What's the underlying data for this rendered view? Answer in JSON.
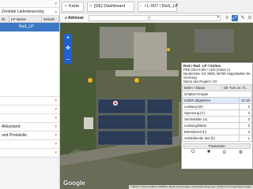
{
  "sidebar": {
    "top_group_label": "Zentrale Ladesteuerung",
    "table_headers": [
      "ID",
      "LP-Name",
      "Details"
    ],
    "selected_row_label": "RaS_LP",
    "bottom_groups": [
      "",
      "",
      "",
      "Akkustand",
      "und Protokolle",
      "",
      ""
    ]
  },
  "tabs": [
    {
      "label": "Karte",
      "type": "close"
    },
    {
      "label": "[DE] Dashboard",
      "type": "close"
    },
    {
      "label": "/ L-007 / RaS_LP",
      "type": "arrow"
    }
  ],
  "toolbar": {
    "address_label": "Adresse",
    "address_value": "",
    "select_value": ""
  },
  "map": {
    "attribution": "©Bilder © 2023 GeoBasis-DE/BKG, Maxar Technologies | Nutzungsbedingungen | Fehler bei Google Maps melden",
    "google_logo": "Google"
  },
  "panel": {
    "title": "RaS / RaS_LP / Online",
    "lines": [
      "FRE-220-H-MV / LED (Class C)",
      "Neubrücker Str. 9928, 55768 Hoppstädten-W...",
      "Germany",
      "Name des Reglers / ID"
    ],
    "status_header": [
      "Belen / Status",
      "DE Turn on / if..."
    ],
    "group_label": "Zeitplan-Gruppe",
    "timestamp_label": "Zuletzt abgelesen",
    "timestamp_value": "21-10",
    "rows": [
      {
        "label": "Leistung (W)",
        "value": "0"
      },
      {
        "label": "Spannung (V)",
        "value": "2"
      },
      {
        "label": "Stromstärke (A)",
        "value": "0"
      },
      {
        "label": "Leistungsfaktor",
        "value": "0"
      },
      {
        "label": "Betriebszeit (h)",
        "value": "0"
      },
      {
        "label": "Verbleibende Zeit (h)",
        "value": "1"
      }
    ],
    "parameter_label": "Parameter"
  }
}
